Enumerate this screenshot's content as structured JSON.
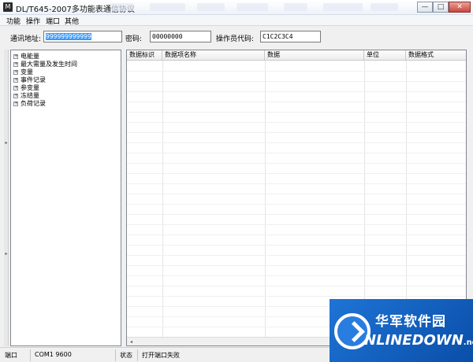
{
  "window": {
    "title": "DL/T645-2007多功能表通信协议",
    "icon_label": "M",
    "controls": {
      "minimize": "—",
      "maximize": "□",
      "close": "✕"
    }
  },
  "menu": [
    "功能",
    "操作",
    "端口",
    "其他"
  ],
  "fields": {
    "address_label": "通讯地址:",
    "address_value": "999999999999",
    "password_label": "密码:",
    "password_value": "00000000",
    "operator_label": "操作员代码:",
    "operator_value": "C1C2C3C4"
  },
  "tree": [
    {
      "expander": "+",
      "label": "电能量"
    },
    {
      "expander": "+",
      "label": "最大需量及发生时间"
    },
    {
      "expander": "+",
      "label": "变量"
    },
    {
      "expander": "+",
      "label": "事件记录"
    },
    {
      "expander": "+",
      "label": "参变量"
    },
    {
      "expander": "+",
      "label": "冻结量"
    },
    {
      "expander": "+",
      "label": "负荷记录"
    }
  ],
  "splitter": {
    "collapse_arrow": "▸"
  },
  "grid": {
    "columns": [
      "数据标识",
      "数据项名称",
      "数据",
      "单位",
      "数据格式"
    ],
    "scroll_left": "◂"
  },
  "status": {
    "port_label": "端口",
    "port_value": "COM1 9600",
    "state_label": "状态",
    "state_value": "打开端口失败"
  },
  "watermark": {
    "brand_cn": "华军软件园",
    "brand_en": "NLINEDOWN",
    "brand_en_suffix": ".net",
    "colors": {
      "background": "#1e74d6",
      "text": "#ffffff"
    }
  }
}
